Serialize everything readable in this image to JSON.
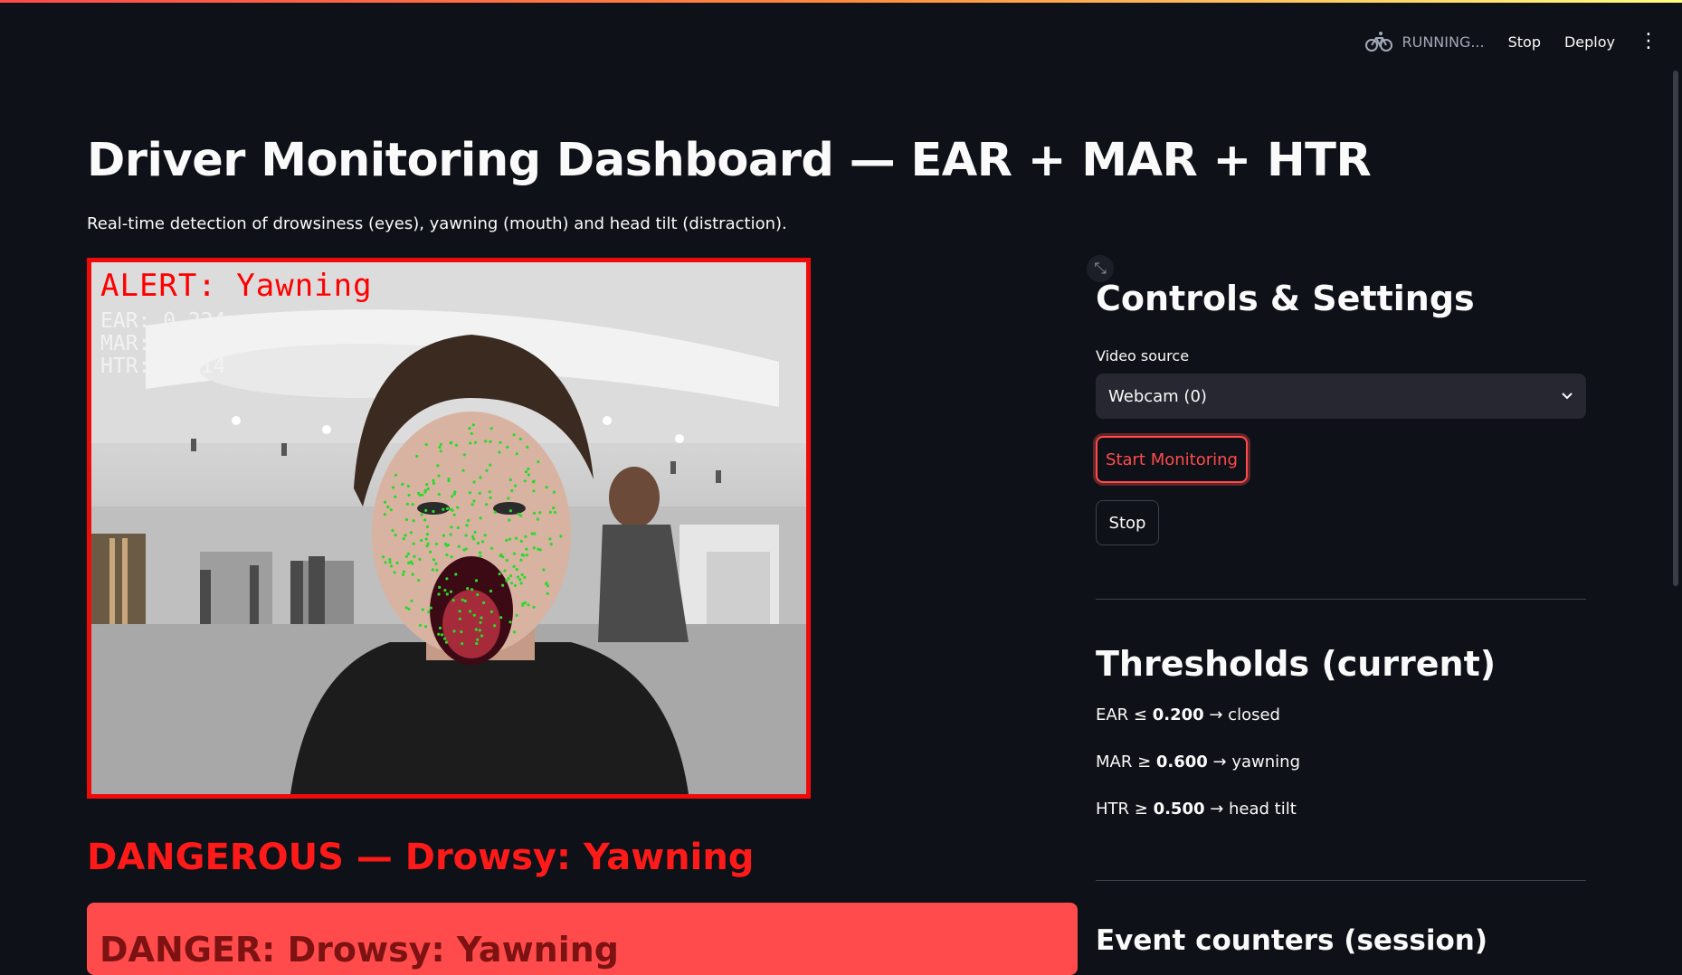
{
  "header": {
    "status_text": "RUNNING...",
    "stop_label": "Stop",
    "deploy_label": "Deploy",
    "menu_icon": "kebab-menu-icon"
  },
  "page": {
    "title": "Driver Monitoring Dashboard — EAR + MAR + HTR",
    "subtitle": "Real-time detection of drowsiness (eyes), yawning (mouth) and head tilt (distraction)."
  },
  "video_overlay": {
    "alert": "ALERT: Yawning",
    "ear": "EAR: 0.224",
    "mar": "MAR: 1.419",
    "htr": "HTR: 0.114"
  },
  "status": {
    "headline": "DANGEROUS — Drowsy: Yawning",
    "box_text": "DANGER: Drowsy: Yawning"
  },
  "controls": {
    "title": "Controls & Settings",
    "video_source_label": "Video source",
    "video_source_value": "Webcam (0)",
    "start_label": "Start Monitoring",
    "stop_label": "Stop"
  },
  "thresholds": {
    "title": "Thresholds (current)",
    "items": [
      {
        "prefix": "EAR ≤ ",
        "value": "0.200",
        "suffix": " → closed"
      },
      {
        "prefix": "MAR ≥ ",
        "value": "0.600",
        "suffix": " → yawning"
      },
      {
        "prefix": "HTR ≥ ",
        "value": "0.500",
        "suffix": " → head tilt"
      }
    ]
  },
  "counters": {
    "title": "Event counters (session)"
  },
  "colors": {
    "background": "#0e1117",
    "accent": "#ff4b4b",
    "alert_red": "#ff1a1a",
    "landmark_green": "#2bd92b"
  }
}
